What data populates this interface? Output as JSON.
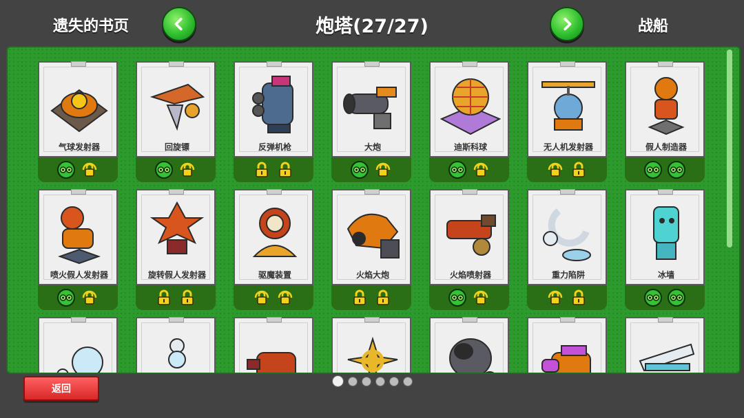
{
  "header": {
    "prev_label": "遗失的书页",
    "title": "炮塔(27/27)",
    "next_label": "战船"
  },
  "colors": {
    "panel": "#2c9a2c",
    "status_bar": "#2a6f15",
    "back_button": "#e23737",
    "nav_button": "#2fbf2f"
  },
  "cards": [
    {
      "name": "气球发射器",
      "art": "balloon-launcher",
      "status": [
        "eyes",
        "lock-spin"
      ]
    },
    {
      "name": "回旋镖",
      "art": "boomerang",
      "status": [
        "eyes",
        "lock-spin"
      ]
    },
    {
      "name": "反弹机枪",
      "art": "bounce-gun",
      "status": [
        "lock",
        "lock"
      ]
    },
    {
      "name": "大炮",
      "art": "cannon",
      "status": [
        "eyes",
        "lock-spin"
      ]
    },
    {
      "name": "迪斯科球",
      "art": "disco-ball",
      "status": [
        "eyes",
        "lock-spin"
      ]
    },
    {
      "name": "无人机发射器",
      "art": "drone-launcher",
      "status": [
        "lock-spin",
        "lock"
      ]
    },
    {
      "name": "假人制造器",
      "art": "dummy-maker",
      "status": [
        "eyes",
        "eyes"
      ]
    },
    {
      "name": "喷火假人发射器",
      "art": "flame-dummy",
      "status": [
        "eyes",
        "lock-spin"
      ]
    },
    {
      "name": "旋转假人发射器",
      "art": "spin-dummy",
      "status": [
        "lock",
        "lock"
      ]
    },
    {
      "name": "驱魔装置",
      "art": "exorcist",
      "status": [
        "lock-spin",
        "lock-spin"
      ]
    },
    {
      "name": "火焰大炮",
      "art": "fire-cannon",
      "status": [
        "lock",
        "lock"
      ]
    },
    {
      "name": "火焰喷射器",
      "art": "flamethrower",
      "status": [
        "eyes",
        "lock-spin"
      ]
    },
    {
      "name": "重力陷阱",
      "art": "gravity-trap",
      "status": [
        "lock-spin",
        "lock"
      ]
    },
    {
      "name": "冰墙",
      "art": "ice-wall",
      "status": [
        "eyes",
        "eyes"
      ]
    },
    {
      "name": "",
      "art": "ice-coil",
      "status": []
    },
    {
      "name": "",
      "art": "ice-tower",
      "status": []
    },
    {
      "name": "",
      "art": "red-turret",
      "status": []
    },
    {
      "name": "",
      "art": "gold-star",
      "status": []
    },
    {
      "name": "",
      "art": "mortar",
      "status": []
    },
    {
      "name": "",
      "art": "purple-turret",
      "status": []
    },
    {
      "name": "",
      "art": "laser",
      "status": []
    }
  ],
  "pagination": {
    "pages": 6,
    "current": 1
  },
  "back_label": "返回"
}
